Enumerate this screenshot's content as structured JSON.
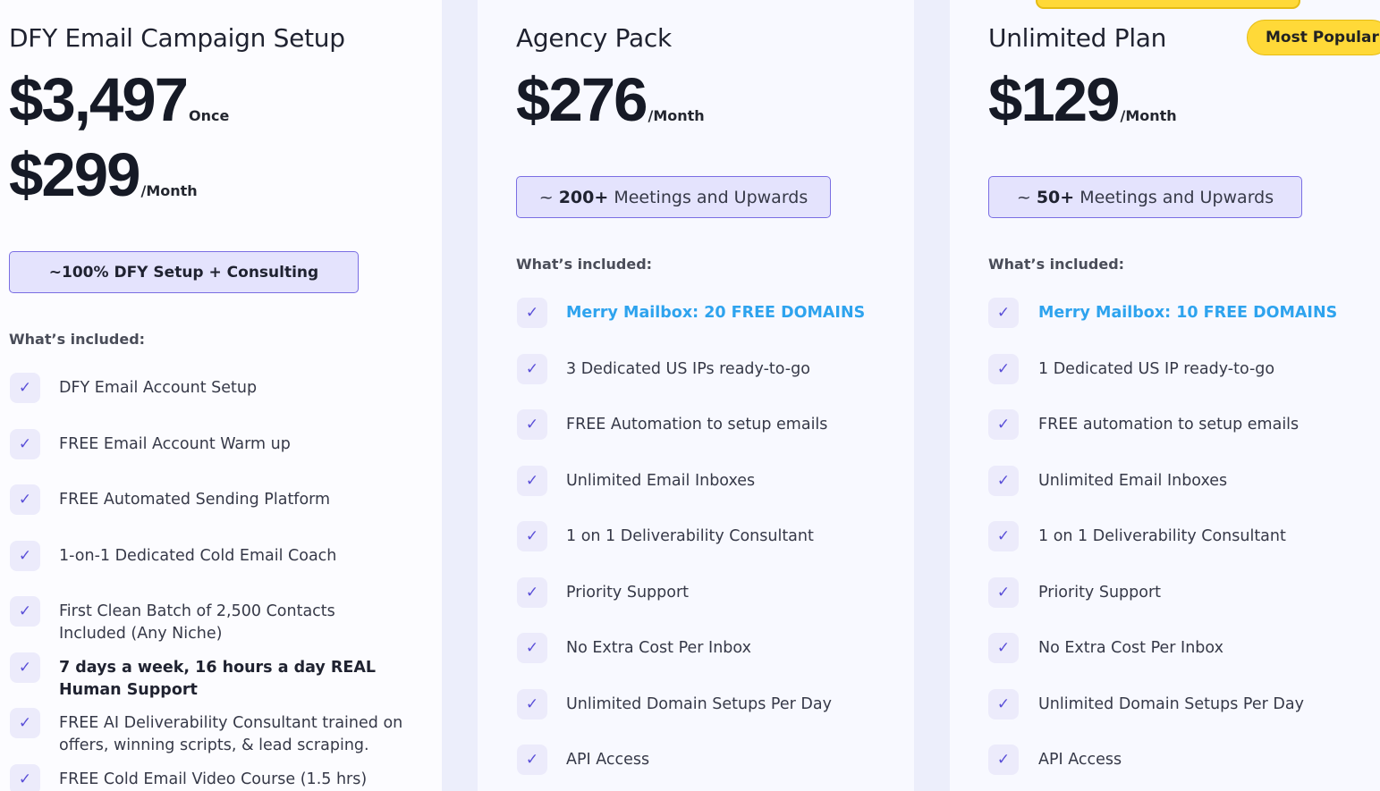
{
  "plans": [
    {
      "title": "DFY Email Campaign Setup",
      "prices": [
        {
          "amount": "$3,497",
          "unit": "Once"
        },
        {
          "amount": "$299",
          "unit": "/Month"
        }
      ],
      "pill": "~100% DFY Setup + Consulting",
      "included_label": "What’s included:",
      "features": [
        {
          "text": "DFY Email Account Setup",
          "style": "normal"
        },
        {
          "text": "FREE Email Account Warm up",
          "style": "normal"
        },
        {
          "text": "FREE Automated Sending Platform",
          "style": "normal"
        },
        {
          "text": "1-on-1 Dedicated Cold Email Coach",
          "style": "normal"
        },
        {
          "text": "First Clean Batch of 2,500 Contacts Included (Any Niche)",
          "style": "normal"
        },
        {
          "text": "7 days a week, 16 hours a day REAL Human Support",
          "style": "bold"
        },
        {
          "text": "FREE AI Deliverability Consultant trained on offers, winning scripts, & lead scraping.",
          "style": "normal"
        },
        {
          "text": "FREE Cold Email Video Course (1.5 hrs)",
          "style": "normal"
        }
      ]
    },
    {
      "title": "Agency Pack",
      "prices": [
        {
          "amount": "$276",
          "unit": "/Month"
        }
      ],
      "pill_prefix": "~ ",
      "pill_bold": "200+",
      "pill_rest": " Meetings and Upwards",
      "included_label": "What’s included:",
      "features": [
        {
          "text": "Merry Mailbox: 20 FREE DOMAINS",
          "style": "blue"
        },
        {
          "text": "3 Dedicated US IPs ready-to-go",
          "style": "normal"
        },
        {
          "text": "FREE Automation to setup emails",
          "style": "normal"
        },
        {
          "text": "Unlimited Email Inboxes",
          "style": "normal"
        },
        {
          "text": "1 on 1 Deliverability Consultant",
          "style": "normal"
        },
        {
          "text": "Priority Support",
          "style": "normal"
        },
        {
          "text": "No Extra Cost Per Inbox",
          "style": "normal"
        },
        {
          "text": "Unlimited Domain Setups Per Day",
          "style": "normal"
        },
        {
          "text": "API Access",
          "style": "normal"
        }
      ]
    },
    {
      "title": "Unlimited Plan",
      "badge": "Most Popular",
      "prices": [
        {
          "amount": "$129",
          "unit": "/Month"
        }
      ],
      "pill_prefix": "~ ",
      "pill_bold": "50+",
      "pill_rest": " Meetings and Upwards",
      "included_label": "What’s included:",
      "features": [
        {
          "text": "Merry Mailbox: 10 FREE DOMAINS",
          "style": "blue"
        },
        {
          "text": "1 Dedicated US IP ready-to-go",
          "style": "normal"
        },
        {
          "text": "FREE automation to setup emails",
          "style": "normal"
        },
        {
          "text": "Unlimited Email Inboxes",
          "style": "normal"
        },
        {
          "text": "1 on 1 Deliverability Consultant",
          "style": "normal"
        },
        {
          "text": "Priority Support",
          "style": "normal"
        },
        {
          "text": "No Extra Cost Per Inbox",
          "style": "normal"
        },
        {
          "text": "Unlimited Domain Setups Per Day",
          "style": "normal"
        },
        {
          "text": "API Access",
          "style": "normal"
        }
      ]
    }
  ],
  "colors": {
    "accent": "#7a6ee3",
    "check": "#5a4fd8",
    "highlight_text": "#2ea3ee",
    "badge": "#ffd938"
  },
  "icons": {
    "feature_check": "check-icon"
  }
}
